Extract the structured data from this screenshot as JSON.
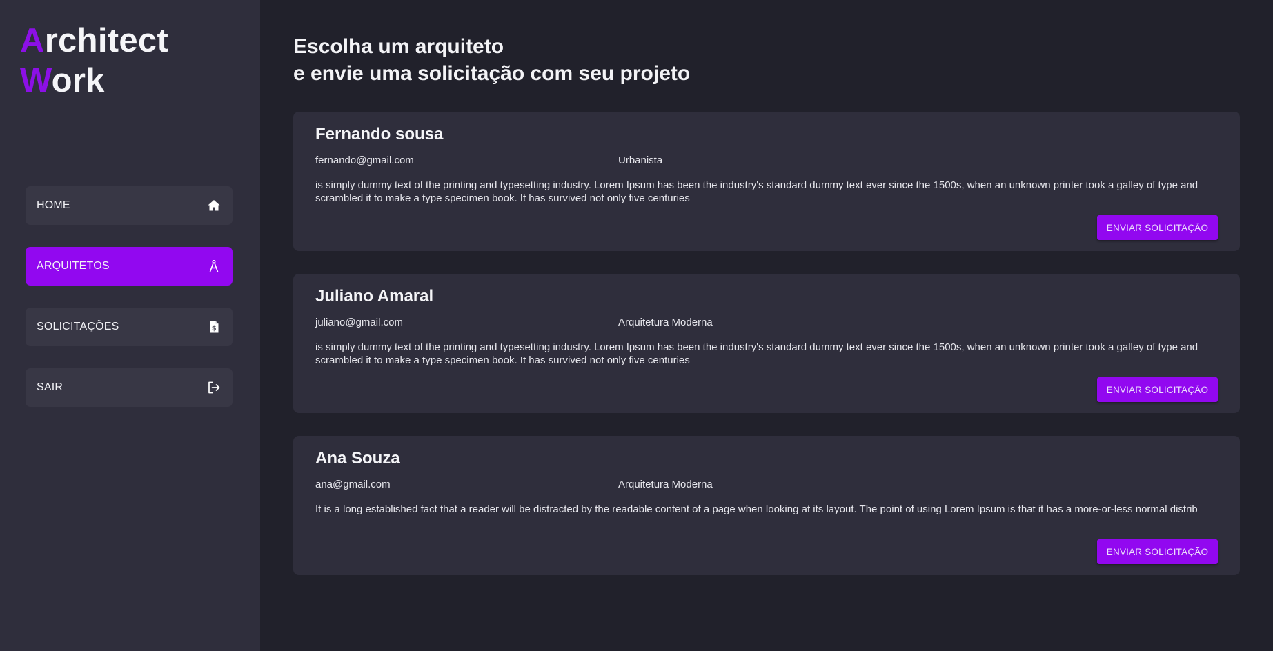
{
  "logo": {
    "line1_accent": "A",
    "line1_rest": "rchitect",
    "line2_accent": "W",
    "line2_rest": "ork"
  },
  "colors": {
    "accent": "#9208f0",
    "sidebar_bg": "#2f2e3c",
    "main_bg": "#21212b",
    "card_bg": "#2f2e3c"
  },
  "nav": {
    "items": [
      {
        "label": "HOME",
        "icon": "home-icon",
        "active": false
      },
      {
        "label": "ARQUITETOS",
        "icon": "compass-icon",
        "active": true
      },
      {
        "label": "SOLICITAÇÕES",
        "icon": "document-dollar-icon",
        "active": false
      },
      {
        "label": "SAIR",
        "icon": "logout-icon",
        "active": false
      }
    ]
  },
  "main": {
    "title_line1": "Escolha um arquiteto",
    "title_line2": "e envie uma solicitação com seu projeto",
    "cards": [
      {
        "name": "Fernando sousa",
        "email": "fernando@gmail.com",
        "specialty": "Urbanista",
        "description": "is simply dummy text of the printing and typesetting industry. Lorem Ipsum has been the industry's standard dummy text ever since the 1500s, when an unknown printer took a galley of type and scrambled it to make a type specimen book. It has survived not only five centuries",
        "button_label": "ENVIAR SOLICITAÇÃO"
      },
      {
        "name": "Juliano Amaral",
        "email": "juliano@gmail.com",
        "specialty": "Arquitetura Moderna",
        "description": "is simply dummy text of the printing and typesetting industry. Lorem Ipsum has been the industry's standard dummy text ever since the 1500s, when an unknown printer took a galley of type and scrambled it to make a type specimen book. It has survived not only five centuries",
        "button_label": "ENVIAR SOLICITAÇÃO"
      },
      {
        "name": "Ana Souza",
        "email": "ana@gmail.com",
        "specialty": "Arquitetura Moderna",
        "description": "It is a long established fact that a reader will be distracted by the readable content of a page when looking at its layout. The point of using Lorem Ipsum is that it has a more-or-less normal distrib",
        "button_label": "ENVIAR SOLICITAÇÃO"
      }
    ]
  }
}
